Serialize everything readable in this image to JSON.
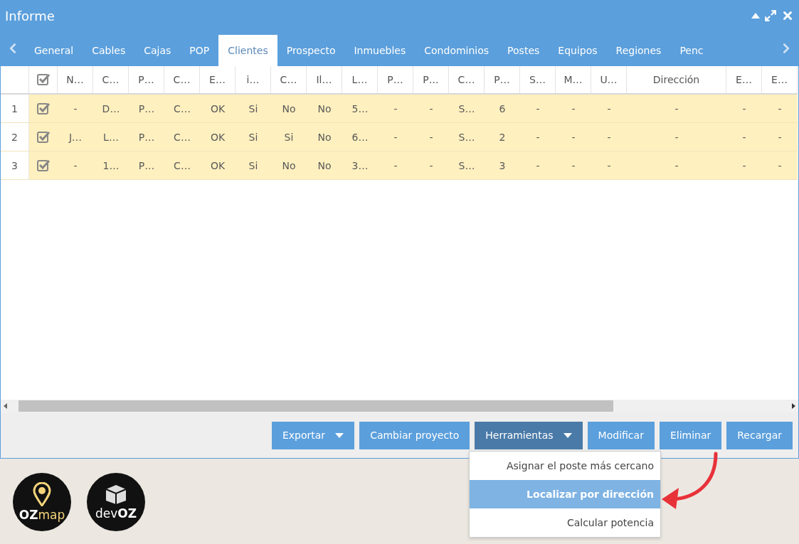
{
  "window": {
    "title": "Informe"
  },
  "tabs": [
    {
      "label": "General",
      "selected": false
    },
    {
      "label": "Cables",
      "selected": false
    },
    {
      "label": "Cajas",
      "selected": false
    },
    {
      "label": "POP",
      "selected": false
    },
    {
      "label": "Clientes",
      "selected": true
    },
    {
      "label": "Prospecto",
      "selected": false
    },
    {
      "label": "Inmuebles",
      "selected": false
    },
    {
      "label": "Condominios",
      "selected": false
    },
    {
      "label": "Postes",
      "selected": false
    },
    {
      "label": "Equipos",
      "selected": false
    },
    {
      "label": "Regiones",
      "selected": false
    },
    {
      "label": "Penc",
      "selected": false
    }
  ],
  "table": {
    "all_checked": true,
    "columns": [
      "N…",
      "C…",
      "P…",
      "C…",
      "E…",
      "i…",
      "C…",
      "Il…",
      "L…",
      "P…",
      "P…",
      "C…",
      "P…",
      "S…",
      "M…",
      "U…",
      "Dirección",
      "E…",
      "E…"
    ],
    "rows": [
      {
        "number": "1",
        "checked": true,
        "cells": [
          "-",
          "D…",
          "P…",
          "C…",
          "OK",
          "Si",
          "No",
          "No",
          "5…",
          "-",
          "-",
          "S…",
          "6",
          "-",
          "-",
          "-",
          "-",
          "-",
          "-"
        ]
      },
      {
        "number": "2",
        "checked": true,
        "cells": [
          "J…",
          "L…",
          "P…",
          "C…",
          "OK",
          "Si",
          "Si",
          "No",
          "6…",
          "-",
          "-",
          "S…",
          "2",
          "-",
          "-",
          "-",
          "-",
          "-",
          "-"
        ]
      },
      {
        "number": "3",
        "checked": true,
        "cells": [
          "-",
          "1…",
          "P…",
          "C…",
          "OK",
          "Si",
          "No",
          "No",
          "3…",
          "-",
          "-",
          "S…",
          "3",
          "-",
          "-",
          "-",
          "-",
          "-",
          "-"
        ]
      }
    ]
  },
  "buttons": [
    {
      "label": "Exportar",
      "dropdown": true,
      "active": false
    },
    {
      "label": "Cambiar proyecto",
      "dropdown": false,
      "active": false
    },
    {
      "label": "Herramientas",
      "dropdown": true,
      "active": true
    },
    {
      "label": "Modificar",
      "dropdown": false,
      "active": false
    },
    {
      "label": "Eliminar",
      "dropdown": false,
      "active": false
    },
    {
      "label": "Recargar",
      "dropdown": false,
      "active": false
    }
  ],
  "menu": {
    "items": [
      {
        "label": "Asignar el poste más cercano",
        "selected": false
      },
      {
        "label": "Localizar por dirección",
        "selected": true
      },
      {
        "label": "Calcular potencia",
        "selected": false
      }
    ]
  },
  "logos": [
    {
      "kind": "pin",
      "parts": [
        {
          "text": "OZ",
          "bold": true
        },
        {
          "text": "map",
          "bold": false
        }
      ]
    },
    {
      "kind": "box",
      "parts": [
        {
          "text": "dev",
          "bold": false
        },
        {
          "text": "OZ",
          "bold": true
        }
      ]
    }
  ]
}
